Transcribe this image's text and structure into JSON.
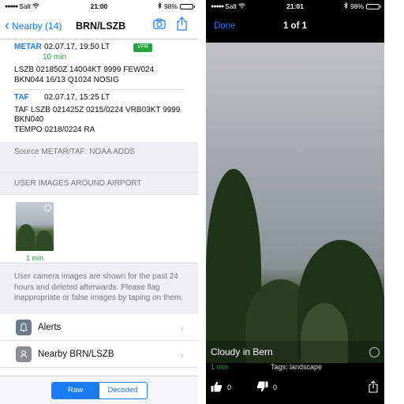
{
  "left": {
    "status": {
      "carrier": "Salt",
      "time": "21:00",
      "battery": "98%"
    },
    "nav": {
      "back_label": "Nearby (14)",
      "title": "BRN/LSZB"
    },
    "metar": {
      "type": "METAR",
      "date": "02.07.17, 19:50 LT",
      "badge": "VFR",
      "age": "10 min",
      "raw": "LSZB 021850Z 14004KT 9999 FEW024 BKN044 16/13 Q1024 NOSIG"
    },
    "taf": {
      "type": "TAF",
      "date": "02.07.17, 15:25 LT",
      "raw1": "TAF LSZB 021425Z 0215/0224 VRB03KT 9999 BKN040",
      "raw2": "TEMPO 0218/0224 RA"
    },
    "source": "Source METAR/TAF: NOAA ADDS",
    "images_header": "USER IMAGES AROUND AIRPORT",
    "thumb_age": "1 min",
    "note": "User camera images are shown for the past 24 hours and deleted afterwards. Please flag inappropriate or false images by taping on them.",
    "cells": [
      {
        "label": "Alerts",
        "icon": "bell-icon"
      },
      {
        "label": "Nearby BRN/LSZB",
        "icon": "location-icon"
      }
    ],
    "segments": {
      "raw": "Raw",
      "decoded": "Decoded",
      "selected": "Raw"
    }
  },
  "right": {
    "status": {
      "carrier": "Salt",
      "time": "21:01",
      "battery": "98%"
    },
    "nav": {
      "done": "Done",
      "counter": "1 of 1"
    },
    "caption": "Cloudy in Bern",
    "age": "1 min",
    "tags": "Tags: landscape",
    "likes": "0",
    "dislikes": "0"
  },
  "colors": {
    "accent": "#1a7cf7",
    "vfr": "#25a33c",
    "fresh": "#25a33c"
  }
}
